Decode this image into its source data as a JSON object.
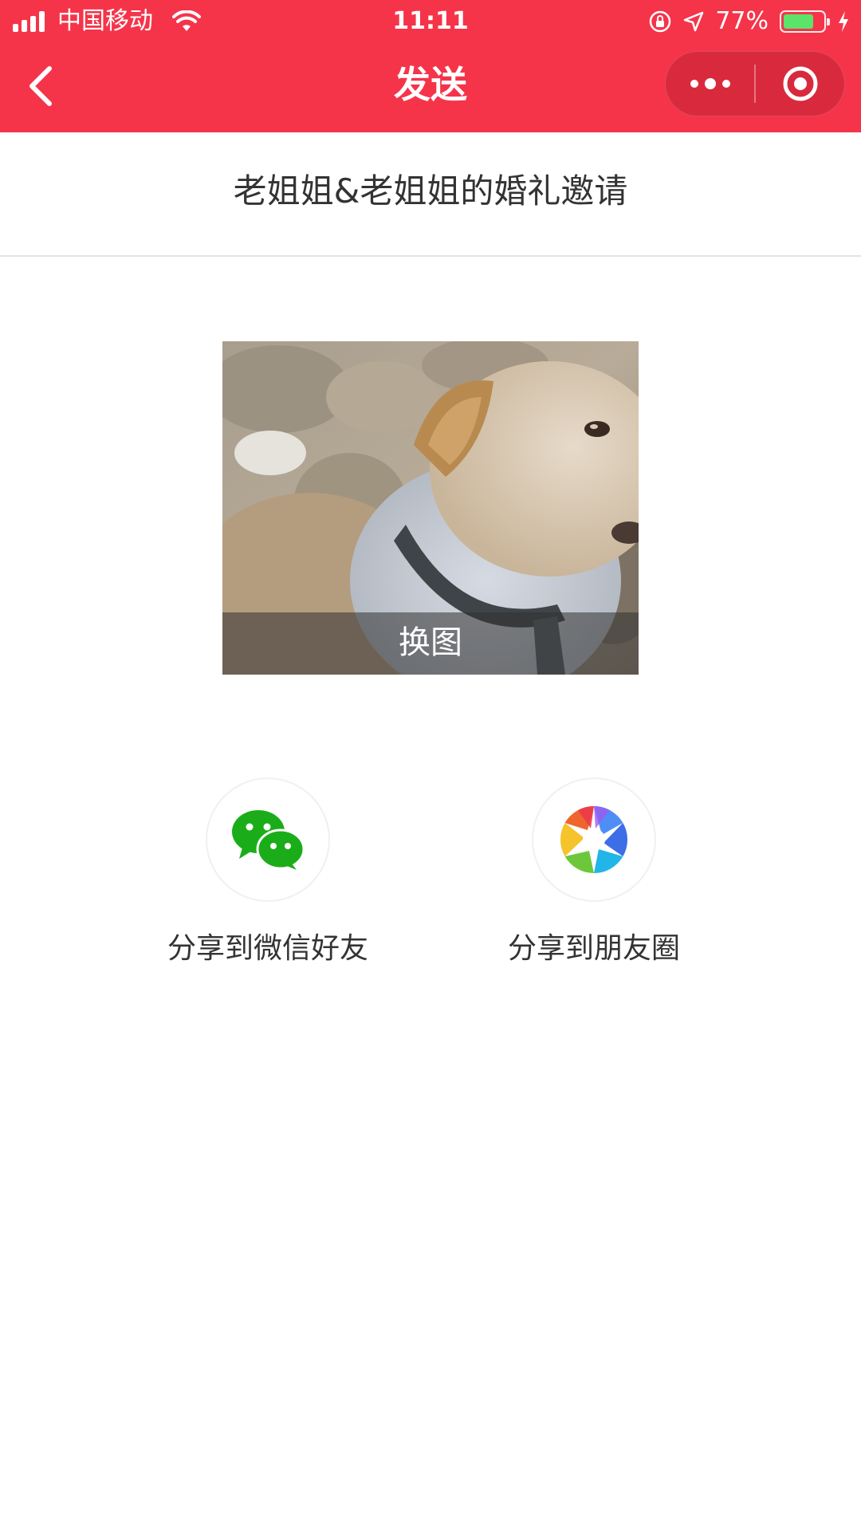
{
  "status_bar": {
    "carrier": "中国移动",
    "time": "11:11",
    "battery": "77%",
    "battery_level": 0.77,
    "icons": [
      "signal-icon",
      "wifi-icon",
      "rotation-lock-icon",
      "location-icon",
      "battery-icon",
      "charging-icon"
    ]
  },
  "nav": {
    "title": "发送",
    "back_icon": "chevron-left-icon",
    "more_icon": "more-dots-icon",
    "close_icon": "target-close-icon"
  },
  "colors": {
    "header_bg": "#f5344a",
    "wechat_green": "#1aad19",
    "text": "#333333"
  },
  "invitation": {
    "title": "老姐姐&老姐姐的婚礼邀请"
  },
  "cover": {
    "change_label": "换图"
  },
  "share": {
    "wechat_friends": "分享到微信好友",
    "moments": "分享到朋友圈",
    "wechat_icon": "wechat-icon",
    "moments_icon": "moments-shutter-icon"
  }
}
